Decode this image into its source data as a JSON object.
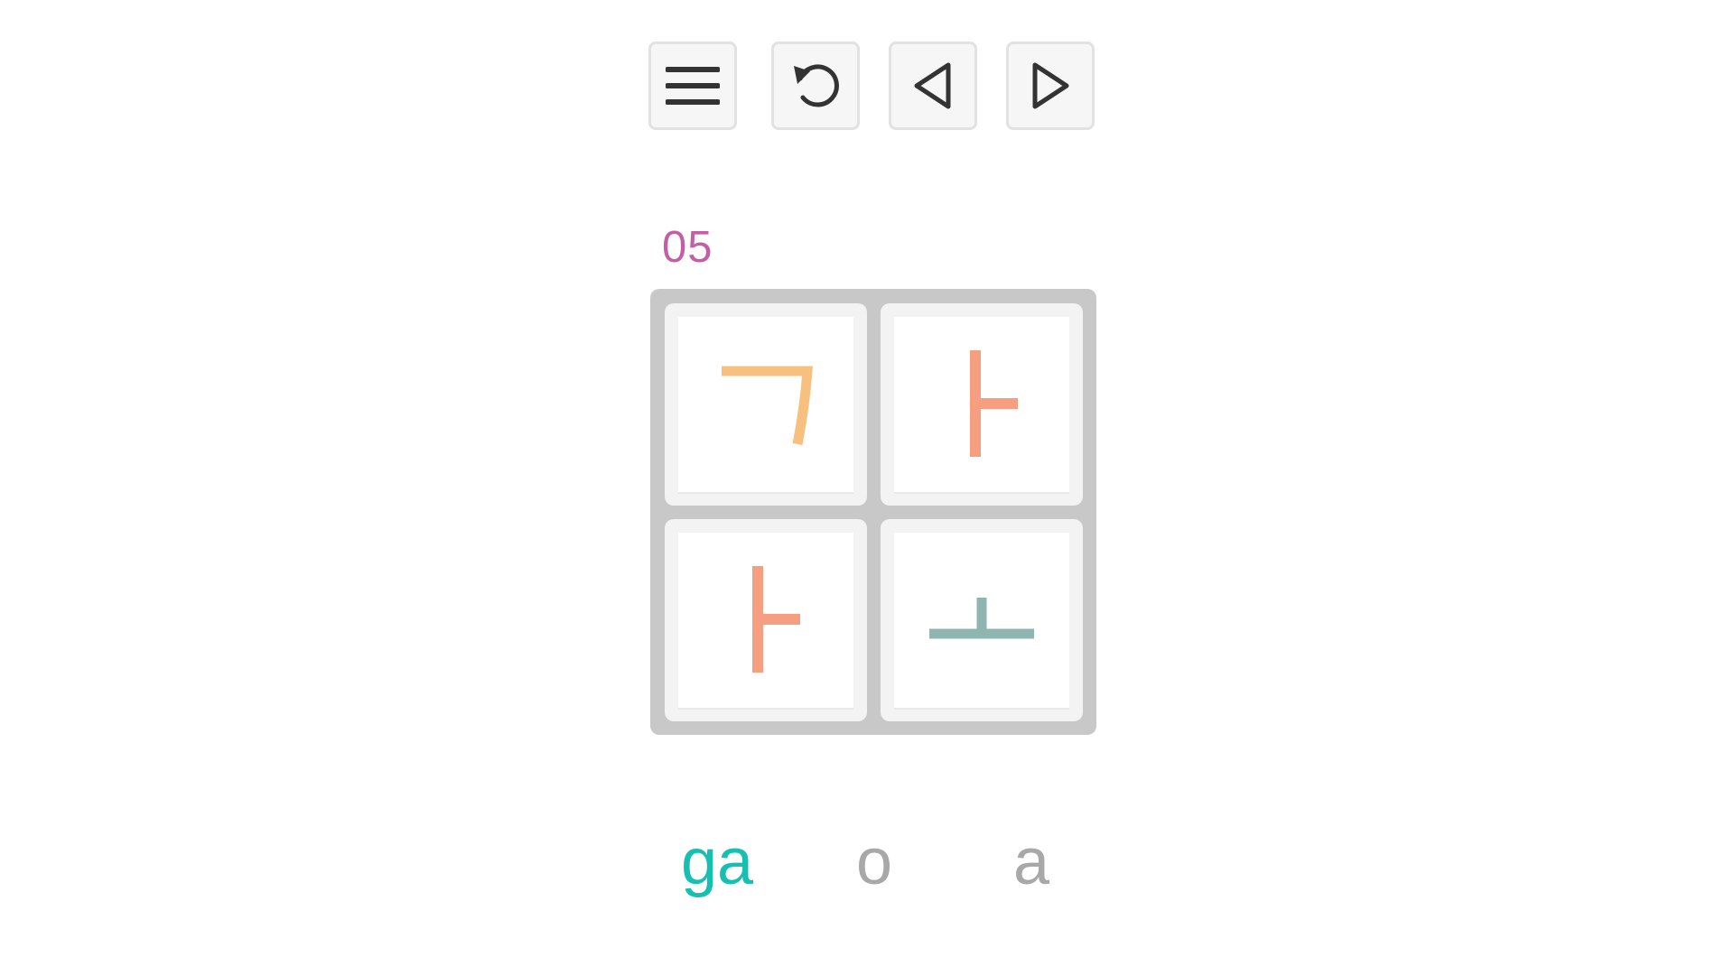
{
  "colors": {
    "level": "#c45fa6",
    "active_syllable": "#17bfb2",
    "inactive_syllable": "#a8a8a8",
    "jamo_giyeok": "#f8c07f",
    "jamo_a": "#f59f80",
    "jamo_o": "#8fb5b1",
    "board_frame": "#c8c8c8",
    "icon": "#333333"
  },
  "toolbar": {
    "buttons": [
      {
        "icon": "menu-icon"
      },
      {
        "icon": "undo-icon"
      },
      {
        "icon": "previous-icon"
      },
      {
        "icon": "next-icon"
      }
    ]
  },
  "level": {
    "number": "05"
  },
  "board": {
    "tiles": [
      {
        "jamo": "ㄱ",
        "icon": "giyeok-icon"
      },
      {
        "jamo": "ㅏ",
        "icon": "a-vowel-icon"
      },
      {
        "jamo": "ㅏ",
        "icon": "a-vowel-icon"
      },
      {
        "jamo": "ㅗ",
        "icon": "o-vowel-icon"
      }
    ]
  },
  "syllables": [
    {
      "text": "ga",
      "state": "active"
    },
    {
      "text": "o",
      "state": "inactive"
    },
    {
      "text": "a",
      "state": "inactive"
    }
  ]
}
